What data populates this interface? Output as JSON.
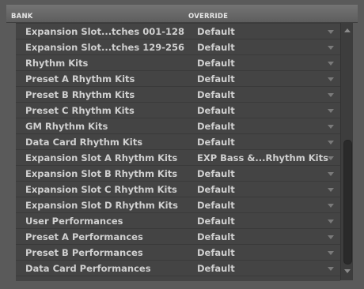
{
  "header": {
    "bank_label": "BANK",
    "override_label": "OVERRIDE"
  },
  "rows": [
    {
      "bank": "Expansion Slot...tches 001-128",
      "override": "Default"
    },
    {
      "bank": "Expansion Slot...tches 129-256",
      "override": "Default"
    },
    {
      "bank": "Rhythm Kits",
      "override": "Default"
    },
    {
      "bank": "Preset A Rhythm Kits",
      "override": "Default"
    },
    {
      "bank": "Preset B Rhythm Kits",
      "override": "Default"
    },
    {
      "bank": "Preset C Rhythm Kits",
      "override": "Default"
    },
    {
      "bank": "GM Rhythm Kits",
      "override": "Default"
    },
    {
      "bank": "Data Card Rhythm Kits",
      "override": "Default"
    },
    {
      "bank": "Expansion Slot A Rhythm Kits",
      "override": "EXP Bass &...Rhythm Kits"
    },
    {
      "bank": "Expansion Slot B Rhythm Kits",
      "override": "Default"
    },
    {
      "bank": "Expansion Slot C Rhythm Kits",
      "override": "Default"
    },
    {
      "bank": "Expansion Slot D Rhythm Kits",
      "override": "Default"
    },
    {
      "bank": "User Performances",
      "override": "Default"
    },
    {
      "bank": "Preset A Performances",
      "override": "Default"
    },
    {
      "bank": "Preset B Performances",
      "override": "Default"
    },
    {
      "bank": "Data Card Performances",
      "override": "Default"
    }
  ],
  "icons": {
    "dropdown": "chevron-down-icon",
    "scroll_up": "arrow-up-icon",
    "scroll_down": "arrow-down-icon"
  },
  "colors": {
    "background": "#5a5a5a",
    "list_background": "#444444",
    "text": "#d0d0d0",
    "header_text": "#e6e6e6"
  }
}
